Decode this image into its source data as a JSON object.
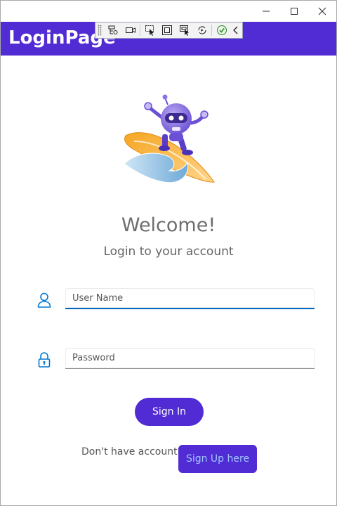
{
  "window": {
    "controls": [
      "minimize",
      "maximize",
      "close"
    ]
  },
  "header": {
    "title": "LoginPage",
    "background": "#512bd4"
  },
  "debug_toolbar": {
    "icons": [
      "live-visual-tree-icon",
      "record-icon",
      "select-element-icon",
      "display-layout-adorners-icon",
      "track-focus-icon",
      "hot-reload-icon",
      "binding-failures-check-icon",
      "collapse-toolbar-icon"
    ]
  },
  "main": {
    "hero_image": "dotnet-bot-surfing-image",
    "welcome": "Welcome!",
    "subtitle": "Login to your account",
    "username": {
      "placeholder": "User Name",
      "value": ""
    },
    "password": {
      "placeholder": "Password",
      "value": ""
    },
    "signin_label": "Sign In",
    "no_account_text": "Don't have account?",
    "signup_label": "Sign Up here"
  },
  "colors": {
    "accent": "#512bd4",
    "icon_blue": "#0078d4",
    "focus_underline": "#0067c0",
    "signup_text": "#9fc6ff"
  }
}
